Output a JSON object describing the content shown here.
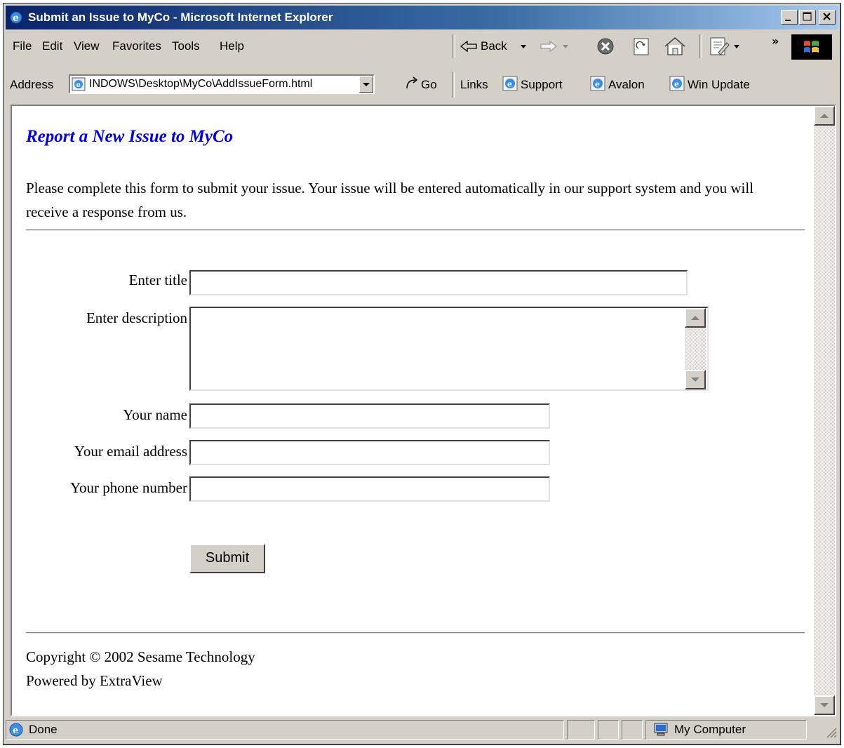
{
  "window": {
    "title": "Submit an Issue to MyCo - Microsoft Internet Explorer"
  },
  "menu": [
    "File",
    "Edit",
    "View",
    "Favorites",
    "Tools",
    "Help"
  ],
  "toolbar": {
    "back_label": "Back",
    "chevron": "»"
  },
  "address": {
    "label": "Address",
    "url": "INDOWS\\Desktop\\MyCo\\AddIssueForm.html",
    "go_label": "Go"
  },
  "links": {
    "label": "Links",
    "items": [
      "Support",
      "Avalon",
      "Win Update"
    ]
  },
  "page": {
    "heading": "Report a New Issue to MyCo",
    "intro": "Please complete this form to submit your issue. Your issue will be entered automatically in our support system and you will receive a response from us.",
    "fields": {
      "title_label": "Enter title",
      "description_label": "Enter description",
      "name_label": "Your name",
      "email_label": "Your email address",
      "phone_label": "Your phone number"
    },
    "submit_label": "Submit",
    "footer": {
      "copyright": "Copyright © 2002 Sesame Technology",
      "powered": "Powered by ExtraView"
    }
  },
  "status": {
    "text": "Done",
    "zone": "My Computer"
  },
  "colors": {
    "titlebar_start": "#0a246a",
    "titlebar_end": "#a6caf0",
    "heading": "#0000ee",
    "chrome": "#d4d0c8"
  }
}
